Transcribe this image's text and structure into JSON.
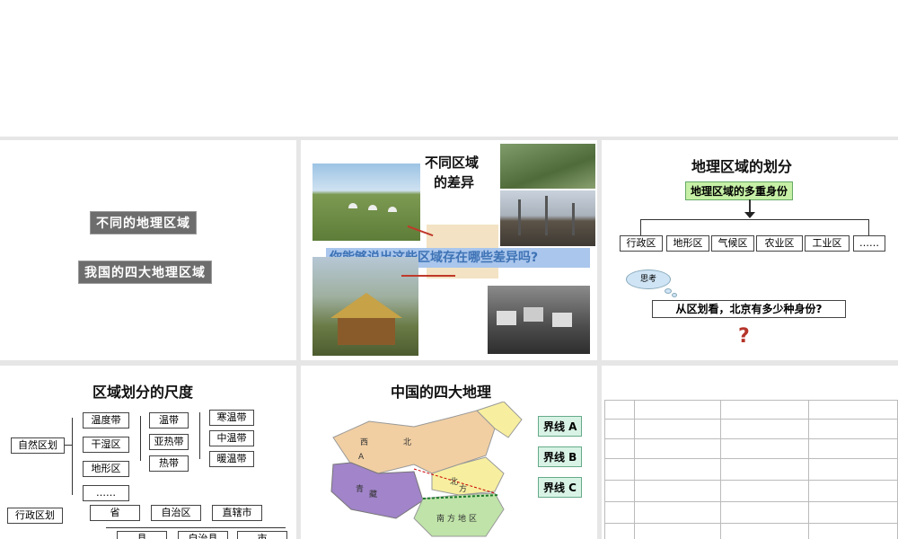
{
  "slide1": {
    "btn1": "不同的地理区域",
    "btn2": "我国的四大地理区域"
  },
  "slide2": {
    "title_line1": "不同区域",
    "title_line2": "的差异",
    "question": "你能够说出这些区域存在哪些差异吗?"
  },
  "slide3": {
    "title": "地理区域的划分",
    "header": "地理区域的多重身份",
    "items": [
      "行政区",
      "地形区",
      "气候区",
      "农业区",
      "工业区",
      "……"
    ],
    "bubble": "思考",
    "question": "从区划看，北京有多少种身份?",
    "mark": "?"
  },
  "slide4": {
    "title": "区域划分的尺度",
    "natural": "自然区划",
    "natural_items": [
      "温度带",
      "干湿区",
      "地形区",
      "……"
    ],
    "temp_items": [
      "温带",
      "亚热带",
      "热带"
    ],
    "temperate_items": [
      "寒温带",
      "中温带",
      "暖温带"
    ],
    "admin": "行政区划",
    "admin_items": [
      "省",
      "自治区",
      "直辖市"
    ],
    "admin_items2": [
      "县",
      "自治县",
      "市"
    ]
  },
  "slide5": {
    "title": "中国的四大地理",
    "labels": [
      "界线 A",
      "界线 B",
      "界线 C"
    ],
    "map_texts": [
      "西",
      "北",
      "地",
      "区",
      "青",
      "藏",
      "地",
      "区",
      "北",
      "方",
      "南",
      "方",
      "地",
      "区",
      "A"
    ]
  }
}
